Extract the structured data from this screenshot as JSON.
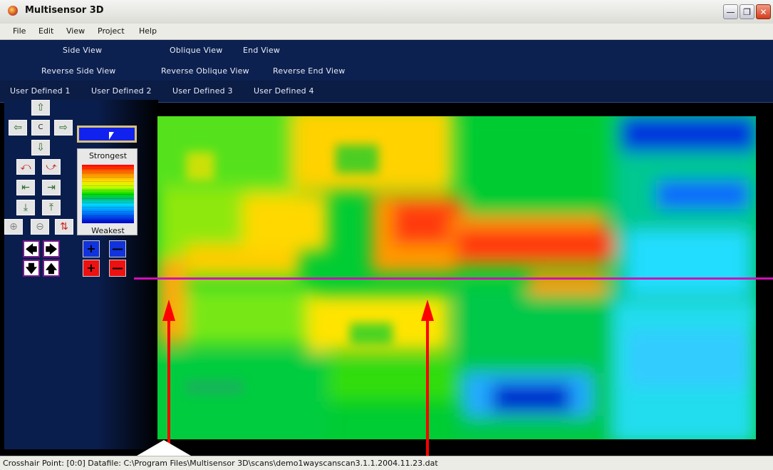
{
  "window": {
    "title": "Multisensor 3D"
  },
  "menu": [
    "File",
    "Edit",
    "View",
    "Project",
    "Help"
  ],
  "view_rows": [
    [
      "Side View",
      "Oblique View",
      "End View"
    ],
    [
      "Reverse Side View",
      "Reverse Oblique View",
      "Reverse End View"
    ],
    [
      "User Defined 1",
      "User Defined 2",
      "User Defined 3",
      "User Defined 4"
    ]
  ],
  "nav_controls": {
    "center_label": "C"
  },
  "legend": {
    "top_label": "Strongest",
    "bottom_label": "Weakest",
    "selected_color": "#1122ee"
  },
  "status": {
    "text": "Crosshair Point: [0:0]  Datafile: C:\\Program Files\\Multisensor 3D\\scans\\demo1wayscanscan3.1.1.2004.11.23.dat"
  },
  "colors": {
    "crosshair": "#d010b8",
    "marker_arrows": "#ff0000",
    "header_bg": "#0d2150"
  }
}
